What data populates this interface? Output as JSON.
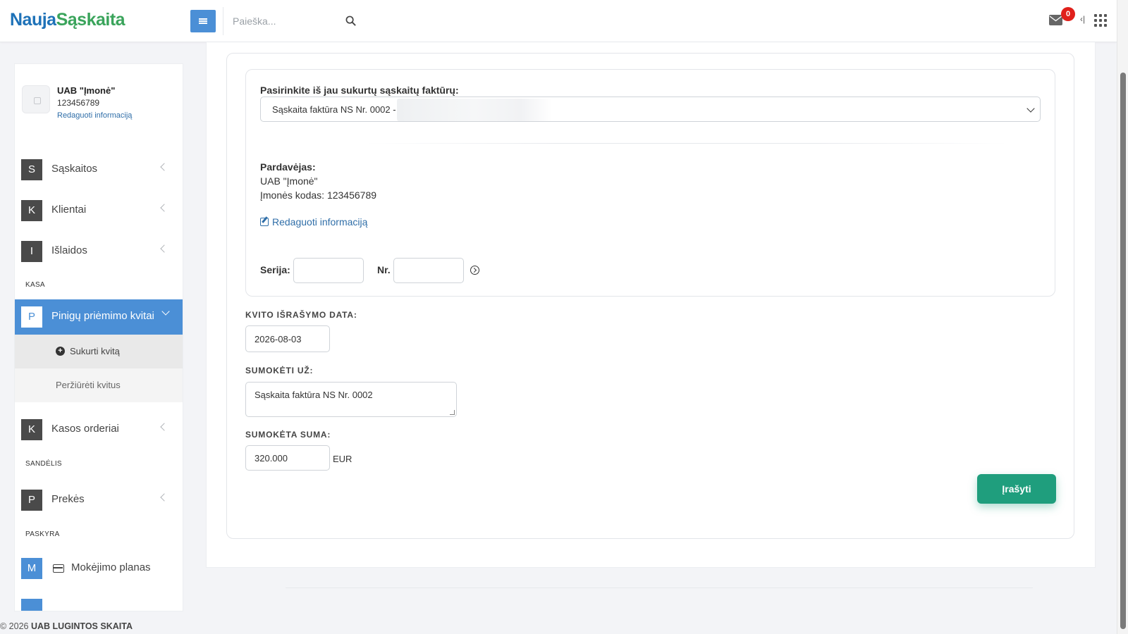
{
  "header": {
    "logo_part1": "Nauja",
    "logo_part2": "Sąskaita",
    "search_placeholder": "Paieška...",
    "mail_count": "0",
    "icons": [
      "menu-icon",
      "search-icon",
      "mail-icon",
      "collapse-icon",
      "apps-grid-icon"
    ]
  },
  "sidebar": {
    "company": {
      "name": "UAB \"Įmonė\"",
      "code": "123456789",
      "edit_link": "Redaguoti informaciją"
    },
    "items": [
      {
        "letter": "S",
        "label": "Sąskaitos"
      },
      {
        "letter": "K",
        "label": "Klientai"
      },
      {
        "letter": "I",
        "label": "Išlaidos"
      },
      {
        "letter": "P",
        "label": "Pinigų priėmimo kvitai"
      },
      {
        "letter": "K",
        "label": "Kasos orderiai"
      },
      {
        "letter": "P",
        "label": "Prekės"
      },
      {
        "letter": "M",
        "label": "Mokėjimo planas"
      }
    ],
    "sections": {
      "kasa": "KASA",
      "sandelis": "SANDĖLIS",
      "paskyra": "PASKYRA"
    },
    "subitems": [
      {
        "label": "Sukurti kvitą"
      },
      {
        "label": "Peržiūrėti kvitus"
      }
    ],
    "colors": {
      "active": "#4b8fd6",
      "letter_bg": "#4a4a4a"
    }
  },
  "form": {
    "select_label": "Pasirinkite iš jau sukurtų sąskaitų faktūrų:",
    "select_value": "Sąskaita faktūra NS Nr. 0002 -",
    "seller_label": "Pardavėjas:",
    "seller_name": "UAB \"Įmonė\"",
    "seller_code": "Įmonės kodas: 123456789",
    "edit_link": "Redaguoti informaciją",
    "serija_label": "Serija:",
    "serija_value": "",
    "nr_label": "Nr.",
    "nr_value": "",
    "date_label": "KVITO IŠRAŠYMO DATA:",
    "date_value": "2026-08-03",
    "pay_for_label": "SUMOKĖTI UŽ:",
    "pay_for_value": "Sąskaita faktūra NS Nr. 0002",
    "amount_label": "SUMOKĖTA SUMA:",
    "amount_value": "320.000",
    "currency": "EUR",
    "save_label": "Įrašyti",
    "save_color": "#1f9e7d"
  },
  "footer": {
    "year_text": "© 2026",
    "company": "UAB LUGINTOS SKAITA"
  }
}
